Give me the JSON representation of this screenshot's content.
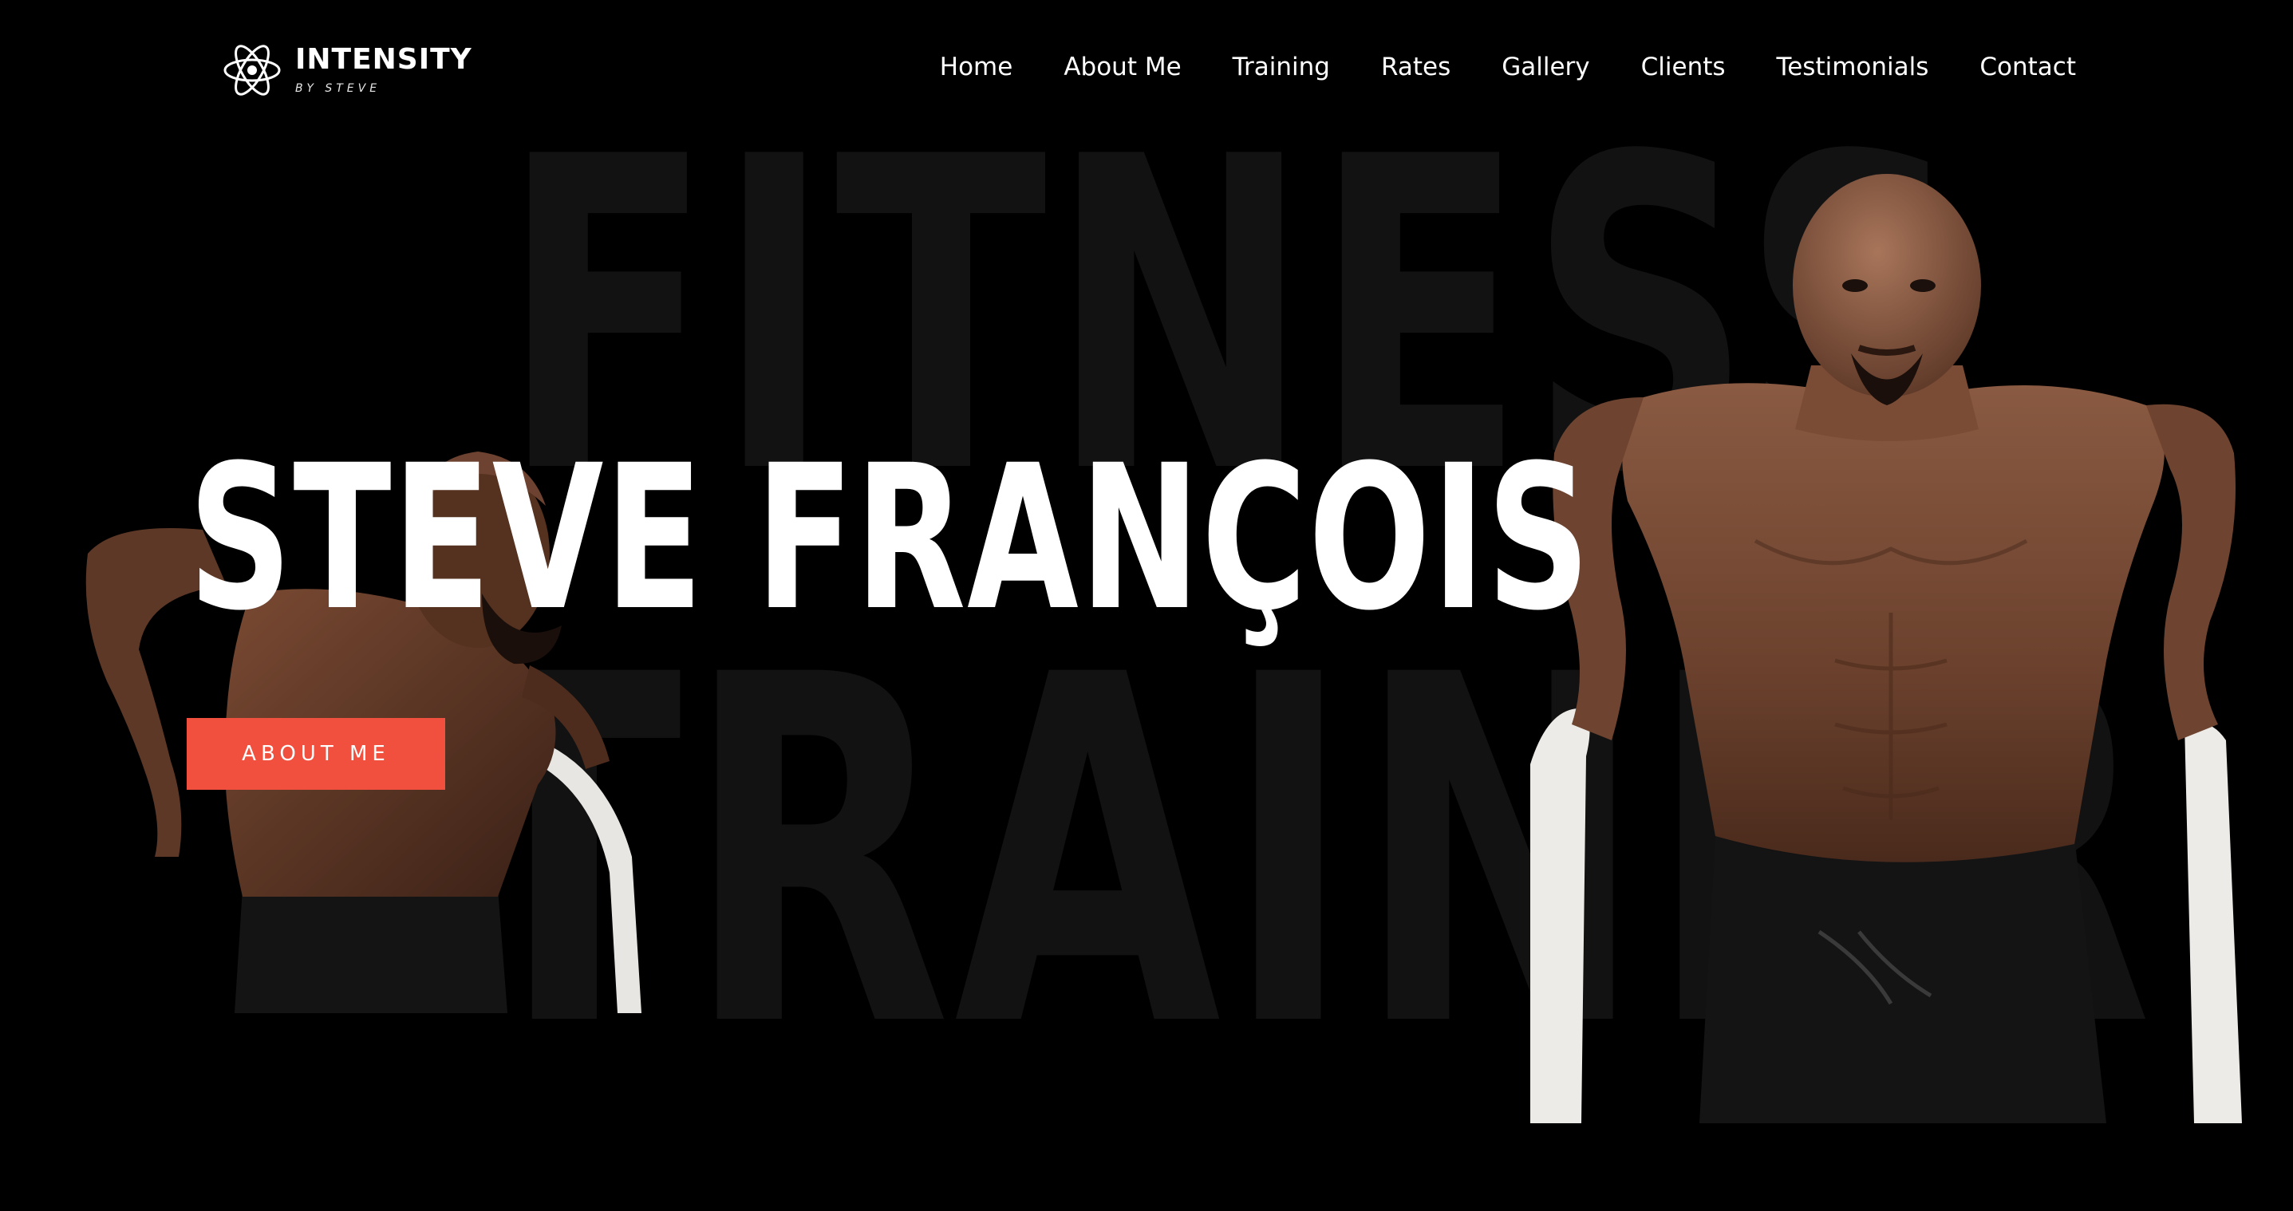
{
  "brand": {
    "title": "INTENSITY",
    "subtitle": "BY STEVE",
    "icon": "atom-icon"
  },
  "nav": {
    "items": [
      {
        "label": "Home"
      },
      {
        "label": "About Me"
      },
      {
        "label": "Training"
      },
      {
        "label": "Rates"
      },
      {
        "label": "Gallery"
      },
      {
        "label": "Clients"
      },
      {
        "label": "Testimonials"
      },
      {
        "label": "Contact"
      }
    ]
  },
  "background": {
    "line1": "FITNESS",
    "line2": "TRAINER"
  },
  "hero": {
    "title": "STEVE FRANÇOIS",
    "cta_label": "ABOUT ME"
  },
  "colors": {
    "background": "#000000",
    "accent": "#f1503f",
    "text": "#ffffff",
    "bg_word": "#121212"
  }
}
